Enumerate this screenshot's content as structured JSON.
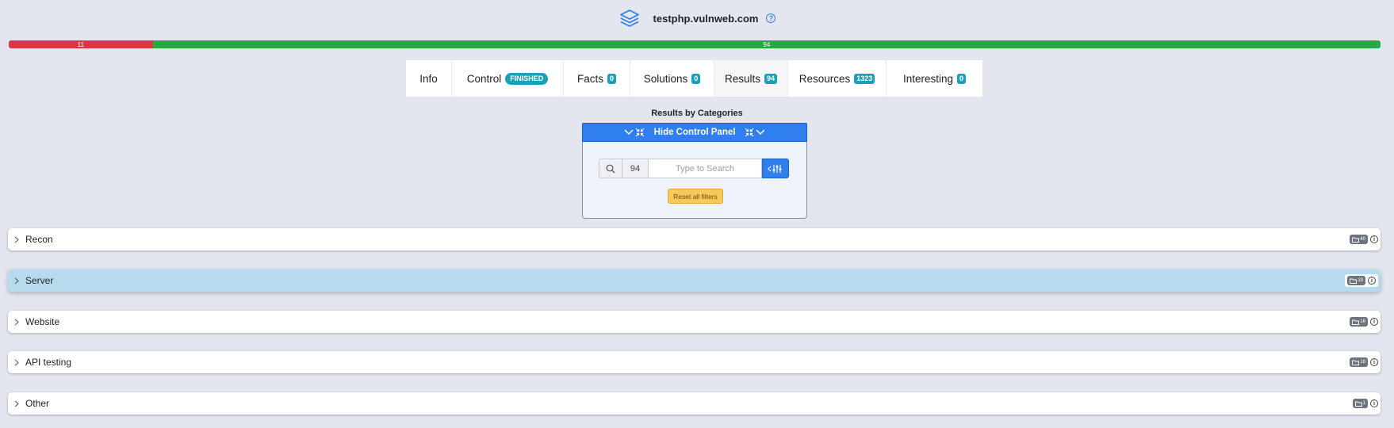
{
  "header": {
    "title": "testphp.vulnweb.com",
    "help": "?"
  },
  "progress": {
    "fail": "11",
    "ok": "94",
    "fail_fraction": 0.105,
    "ok_fraction": 0.895
  },
  "tabs": [
    {
      "label": "Info",
      "badge": ""
    },
    {
      "label": "Control",
      "badge": "FINISHED"
    },
    {
      "label": "Facts",
      "badge": "0"
    },
    {
      "label": "Solutions",
      "badge": "0"
    },
    {
      "label": "Results",
      "badge": "94"
    },
    {
      "label": "Resources",
      "badge": "1323"
    },
    {
      "label": "Interesting",
      "badge": "0"
    }
  ],
  "categories_title": "Results by Categories",
  "control_panel": {
    "hide_label": "Hide Control Panel",
    "count": "94",
    "search_placeholder": "Type to Search",
    "reset_label": "Reset all filters"
  },
  "categories": [
    {
      "label": "Recon",
      "count": "40"
    },
    {
      "label": "Server",
      "count": "19"
    },
    {
      "label": "Website",
      "count": "16"
    },
    {
      "label": "API testing",
      "count": "18"
    },
    {
      "label": "Other",
      "count": "1"
    }
  ],
  "colors": {
    "accent": "#2f7fef",
    "fail": "#dc3545",
    "ok": "#28a745",
    "badge": "#17a2b8",
    "reset": "#f7c95a",
    "highlight": "#b7dbee"
  }
}
